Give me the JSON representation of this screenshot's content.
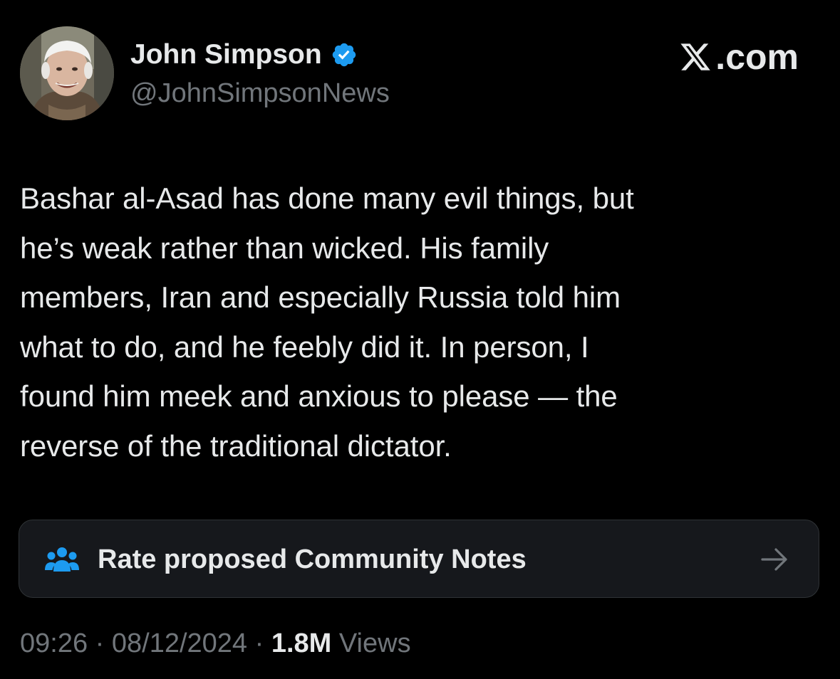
{
  "author": {
    "display_name": "John Simpson",
    "handle": "@JohnSimpsonNews",
    "verified": true
  },
  "brand": {
    "label": ".com",
    "logo_icon": "x-logo-icon"
  },
  "tweet": {
    "text": "Bashar al-Asad has done many evil things, but\nhe’s weak rather than wicked.  His family\nmembers, Iran and especially Russia told him\nwhat to do, and he feebly did it.  In person, I\nfound him meek and anxious to please — the\nreverse of the traditional dictator."
  },
  "community_notes": {
    "label": "Rate proposed Community Notes",
    "icon": "people-icon",
    "arrow_icon": "arrow-right-icon"
  },
  "meta": {
    "time": "09:26",
    "separator": " · ",
    "date": "08/12/2024",
    "views_count": "1.8M",
    "views_label": " Views"
  },
  "colors": {
    "background": "#000000",
    "text_primary": "#e7e9ea",
    "text_secondary": "#71767b",
    "verified_blue": "#1d9bf0",
    "card_background": "#16181c"
  }
}
